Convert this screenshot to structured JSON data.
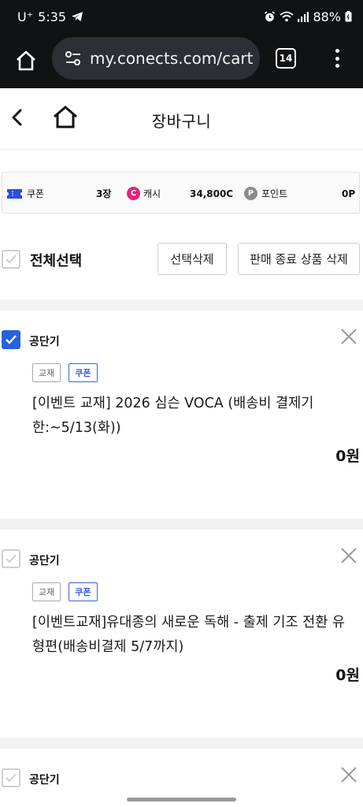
{
  "status_bar": {
    "carrier": "U⁺",
    "time": "5:35",
    "battery": "88%"
  },
  "browser": {
    "url": "my.conects.com/cart",
    "tab_count": "14"
  },
  "header": {
    "title": "장바구니"
  },
  "benefits": {
    "coupon_label": "쿠폰",
    "coupon_value": "3장",
    "cash_badge": "C",
    "cash_label": "캐시",
    "cash_value": "34,800C",
    "point_badge": "P",
    "point_label": "포인트",
    "point_value": "0P"
  },
  "selection": {
    "select_all_label": "전체선택",
    "delete_selected_label": "선택삭제",
    "delete_ended_label": "판매 종료 상품 삭제"
  },
  "cart_items": [
    {
      "seller": "공단기",
      "checked": true,
      "tags": [
        "교재",
        "쿠폰"
      ],
      "name": "[이벤트 교재] 2026 심슨 VOCA (배송비 결제기한:~5/13(화))",
      "price": "0원"
    },
    {
      "seller": "공단기",
      "checked": false,
      "tags": [
        "교재",
        "쿠폰"
      ],
      "name": "[이벤트교재]유대종의 새로운 독해 - 출제 기조 전환 유형편(배송비결제 5/7까지)",
      "price": "0원"
    },
    {
      "seller": "공단기",
      "checked": false
    }
  ],
  "colors": {
    "accent": "#2563dc",
    "coupon_tag": "#3b5fe0",
    "cash": "#e8227a",
    "point": "#8b8b8b",
    "topbar": "#111214"
  },
  "icons": [
    "telegram-icon",
    "alarm-icon",
    "wifi-icon",
    "signal-icon",
    "battery-icon",
    "home-icon",
    "site-settings-icon",
    "tabs-icon",
    "more-vert-icon",
    "back-icon",
    "coupon-icon",
    "check-icon",
    "close-icon"
  ]
}
